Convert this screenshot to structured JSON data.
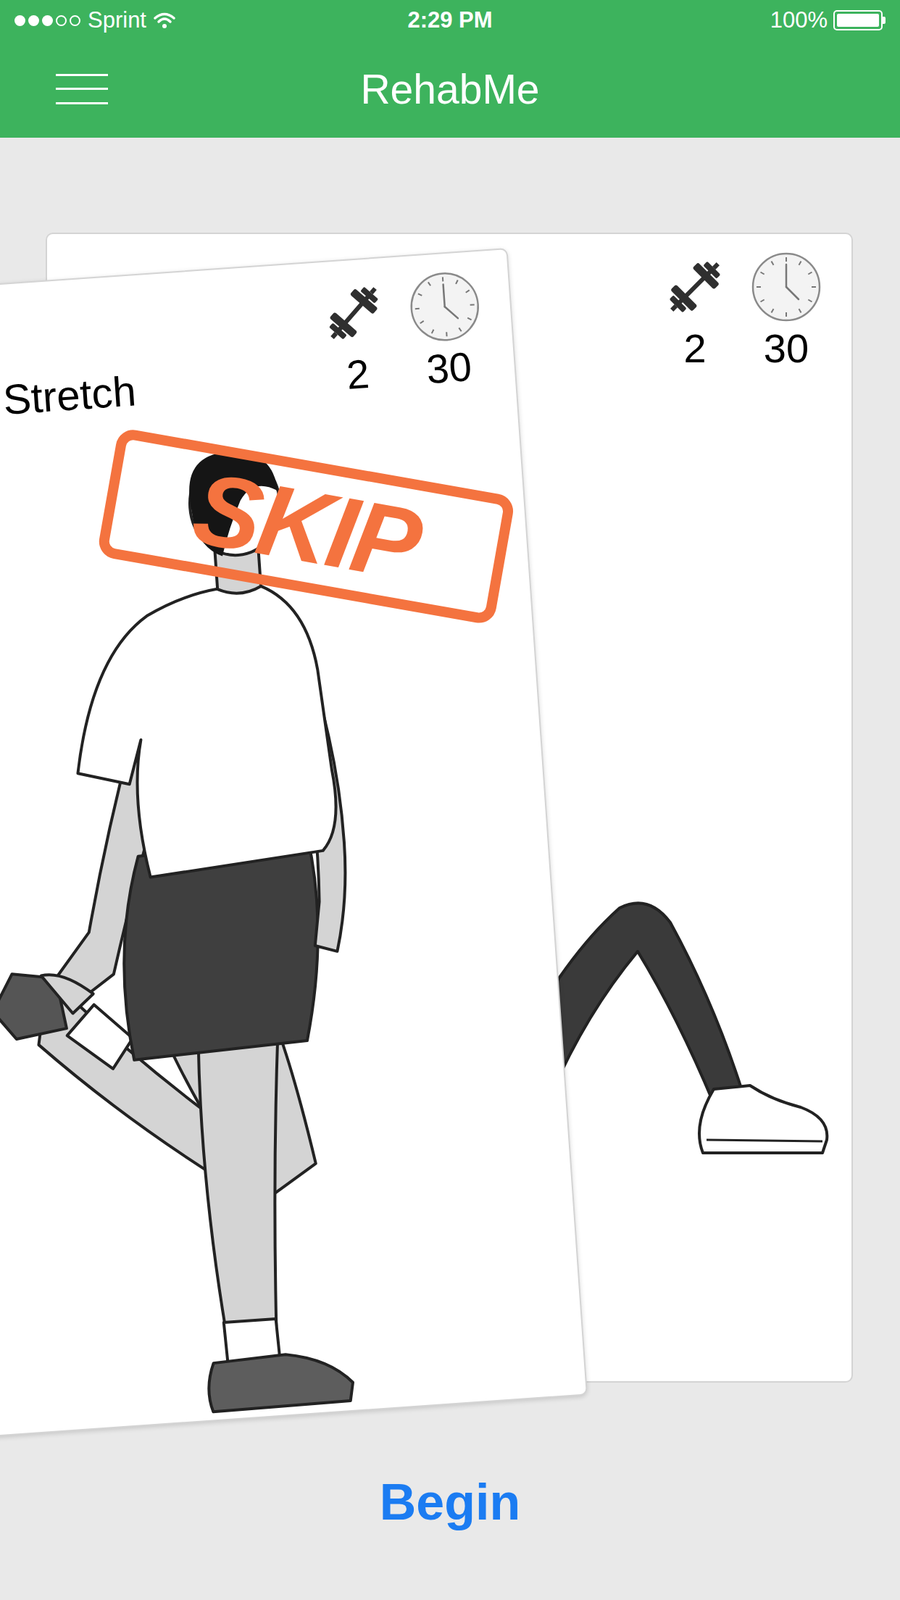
{
  "status_bar": {
    "carrier": "Sprint",
    "signal_dots": 3,
    "time": "2:29 PM",
    "battery": "100%",
    "battery_level": 1
  },
  "nav": {
    "title": "RehabMe"
  },
  "cards": [
    {
      "kind": "standing",
      "title": "Stretch",
      "sets": "2",
      "seconds": "30",
      "stamp": "SKIP",
      "swiping": true
    },
    {
      "kind": "lying",
      "sets": "2",
      "seconds": "30",
      "swiping": false
    }
  ],
  "buttons": [
    "Begin"
  ]
}
